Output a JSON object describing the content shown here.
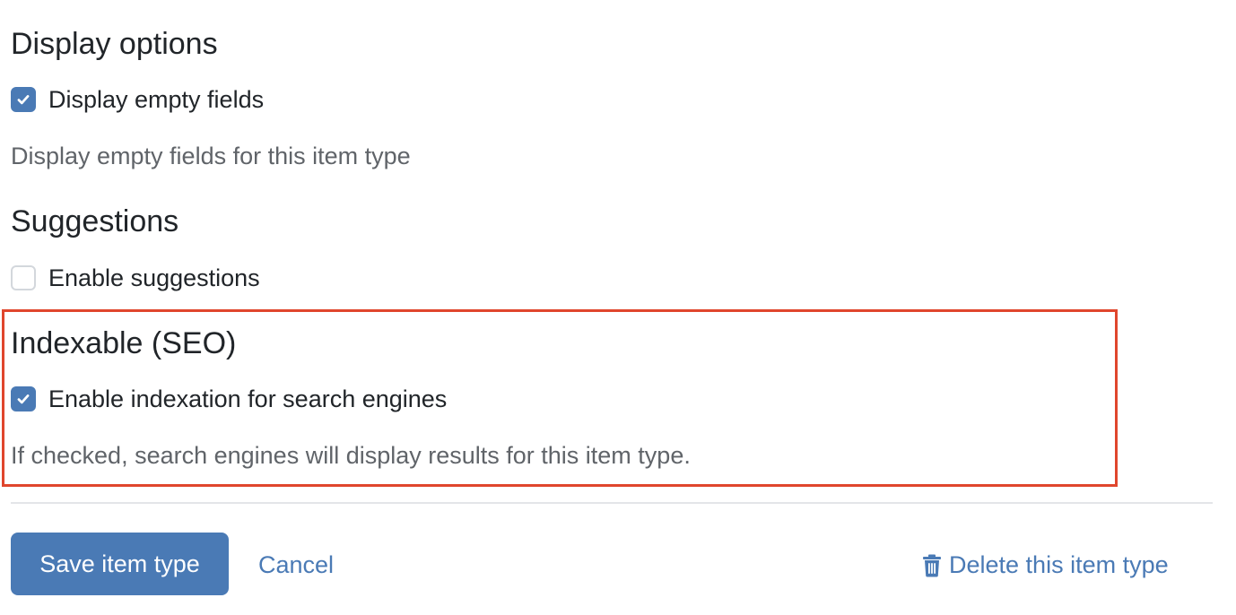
{
  "display_options": {
    "heading": "Display options",
    "checkbox_label": "Display empty fields",
    "checked": true,
    "help_text": "Display empty fields for this item type"
  },
  "suggestions": {
    "heading": "Suggestions",
    "checkbox_label": "Enable suggestions",
    "checked": false
  },
  "seo": {
    "heading": "Indexable (SEO)",
    "checkbox_label": "Enable indexation for search engines",
    "checked": true,
    "help_text": "If checked, search engines will display results for this item type.",
    "highlight_color": "#e0462d"
  },
  "actions": {
    "save_label": "Save item type",
    "cancel_label": "Cancel",
    "delete_label": "Delete this item type",
    "delete_icon": "trash-icon"
  },
  "colors": {
    "accent": "#4a7ab5",
    "text": "#212529",
    "muted_text": "#606469"
  }
}
